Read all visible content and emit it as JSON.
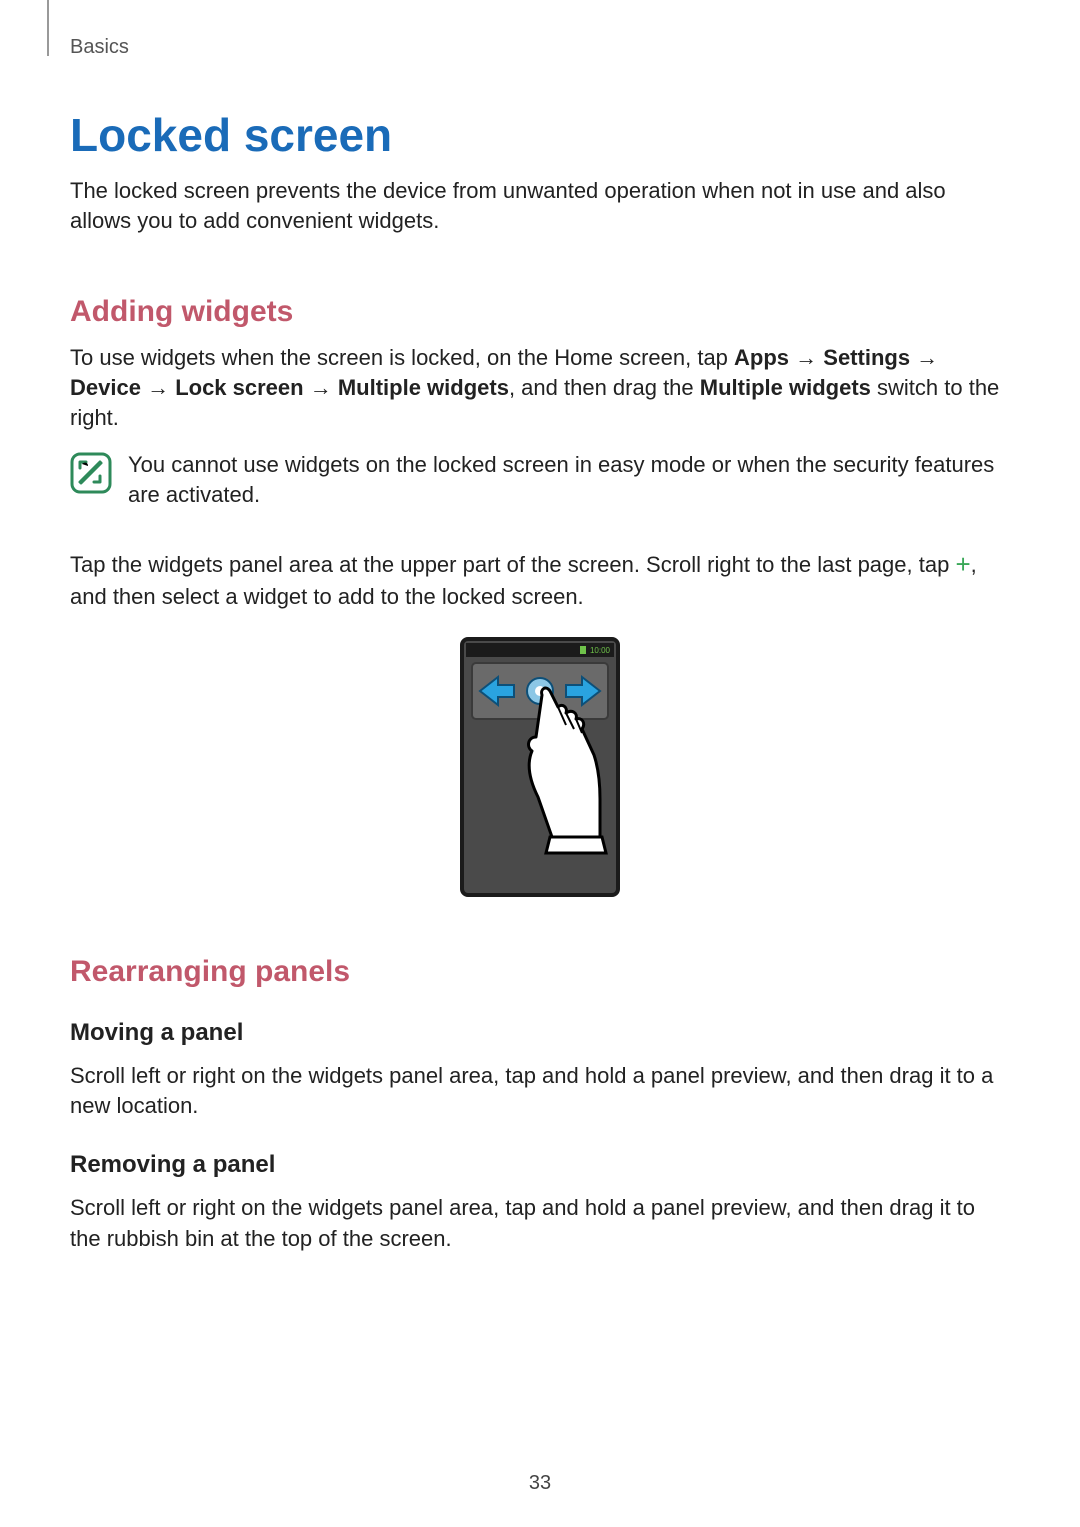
{
  "breadcrumb": "Basics",
  "title": "Locked screen",
  "intro": "The locked screen prevents the device from unwanted operation when not in use and also allows you to add convenient widgets.",
  "section1": {
    "heading": "Adding widgets",
    "p1_pre": "To use widgets when the screen is locked, on the Home screen, tap ",
    "apps": "Apps",
    "arrow": " → ",
    "settings": "Settings",
    "device": "Device",
    "lockscreen": "Lock screen",
    "multiple": "Multiple widgets",
    "p1_mid": ", and then drag the ",
    "multiple2": "Multiple widgets",
    "p1_end": " switch to the right.",
    "note": "You cannot use widgets on the locked screen in easy mode or when the security features are activated.",
    "p2_pre": "Tap the widgets panel area at the upper part of the screen. Scroll right to the last page, tap ",
    "plus": "+",
    "p2_end": ", and then select a widget to add to the locked screen.",
    "status_time": "10:00"
  },
  "section2": {
    "heading": "Rearranging panels",
    "sub1": "Moving a panel",
    "sub1_text": "Scroll left or right on the widgets panel area, tap and hold a panel preview, and then drag it to a new location.",
    "sub2": "Removing a panel",
    "sub2_text": "Scroll left or right on the widgets panel area, tap and hold a panel preview, and then drag it to the rubbish bin at the top of the screen."
  },
  "page_number": "33"
}
